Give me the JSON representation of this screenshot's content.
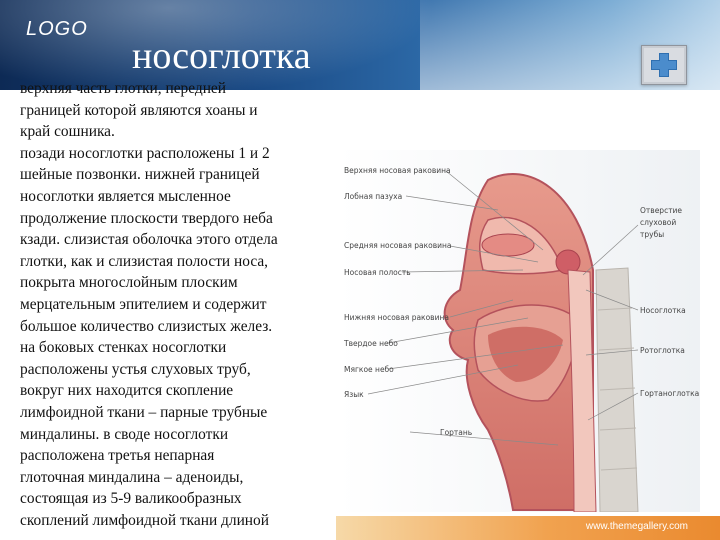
{
  "header": {
    "logo": "LOGO",
    "title": "носоглотка"
  },
  "body_lines": [
    "верхняя часть глотки, передней",
    "границей которой являются хоаны и",
    "край сошника.",
    " позади носоглотки расположены 1 и 2",
    "шейные позвонки. нижней границей",
    "носоглотки является мысленное",
    "продолжение плоскости твердого неба",
    "кзади. слизистая оболочка этого отдела",
    "глотки, как и слизистая полости носа,",
    "покрыта многослойным плоским",
    "мерцательным эпителием и содержит",
    "большое количество слизистых желез.",
    "на боковых стенках носоглотки",
    "расположены устья слуховых труб,",
    "вокруг них находится скопление",
    "лимфоидной ткани – парные трубные",
    "миндалины. в своде носоглотки",
    "расположена третья непарная",
    "глоточная миндалина – аденоиды,",
    "состоящая из 5-9 валикообразных",
    "скоплений лимфоидной ткани длиной"
  ],
  "figure": {
    "labels_left": [
      "Верхняя носовая раковина",
      "Лобная пазуха",
      "Средняя носовая раковина",
      "Носовая полость",
      "Нижняя носовая раковина",
      "Твердое небо",
      "Мягкое небо",
      "Язык",
      "Гортань"
    ],
    "labels_right": [
      "Отверстие",
      "слуховой",
      "трубы",
      "Носоглотка",
      "Ротоглотка",
      "Гортаноглотка"
    ]
  },
  "footer": {
    "url": "www.themegallery.com"
  },
  "colors": {
    "header_dark": "#0d2a55",
    "footer_orange": "#f1a24f",
    "tissue_pink": "#d98377",
    "tissue_dark": "#b4525c"
  }
}
